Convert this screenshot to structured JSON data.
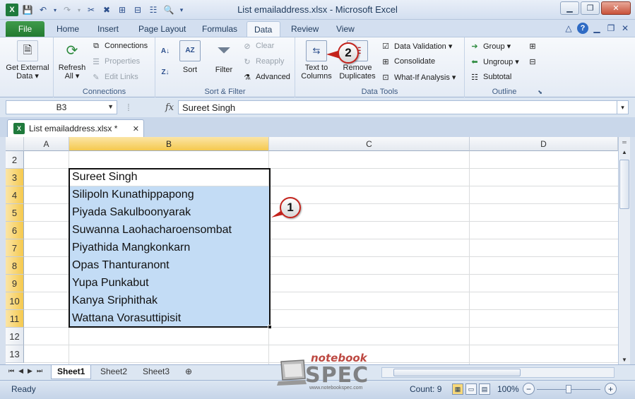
{
  "window": {
    "title": "List emailaddress.xlsx - Microsoft Excel"
  },
  "tabs": {
    "file": "File",
    "home": "Home",
    "insert": "Insert",
    "page_layout": "Page Layout",
    "formulas": "Formulas",
    "data": "Data",
    "review": "Review",
    "view": "View"
  },
  "ribbon": {
    "get_external": {
      "line1": "Get External",
      "line2": "Data ▾"
    },
    "connections_group": {
      "refresh_line1": "Refresh",
      "refresh_line2": "All ▾",
      "connections": "Connections",
      "properties": "Properties",
      "edit_links": "Edit Links",
      "label": "Connections"
    },
    "sort_filter": {
      "sort": "Sort",
      "filter": "Filter",
      "clear": "Clear",
      "reapply": "Reapply",
      "advanced": "Advanced",
      "label": "Sort & Filter"
    },
    "data_tools": {
      "text_to_columns_line1": "Text to",
      "text_to_columns_line2": "Columns",
      "remove_duplicates_line1": "Remove",
      "remove_duplicates_line2": "Duplicates",
      "data_validation": "Data Validation ▾",
      "consolidate": "Consolidate",
      "what_if": "What-If Analysis ▾",
      "label": "Data Tools"
    },
    "outline": {
      "group": "Group ▾",
      "ungroup": "Ungroup ▾",
      "subtotal": "Subtotal",
      "label": "Outline"
    }
  },
  "formula_bar": {
    "name_box": "B3",
    "fx": "fx",
    "value": "Sureet Singh"
  },
  "workbook_tab": {
    "label": "List emailaddress.xlsx  *"
  },
  "grid": {
    "columns": [
      "A",
      "B",
      "C",
      "D"
    ],
    "rows": [
      "2",
      "3",
      "4",
      "5",
      "6",
      "7",
      "8",
      "9",
      "10",
      "11",
      "12",
      "13"
    ],
    "cells_b": [
      "",
      "Sureet Singh",
      "Silipoln Kunathippapong",
      "Piyada Sakulboonyarak",
      "Suwanna Laohacharoensombat",
      "Piyathida Mangkonkarn",
      "Opas Thanturanont",
      "Yupa Punkabut",
      "Kanya Sriphithak",
      "Wattana Vorasuttipisit",
      "",
      ""
    ]
  },
  "callouts": {
    "one": "1",
    "two": "2"
  },
  "sheets": [
    "Sheet1",
    "Sheet2",
    "Sheet3"
  ],
  "status": {
    "ready": "Ready",
    "count": "Count: 9",
    "zoom": "100%"
  },
  "watermark": {
    "top": "notebook",
    "brand": "SPEC",
    "url": "www.notebookspec.com"
  },
  "colors": {
    "selection_fill": "#c3dcf5",
    "header_selected": "#f5c94e",
    "callout_red": "#c4231c",
    "file_tab": "#237a30"
  }
}
